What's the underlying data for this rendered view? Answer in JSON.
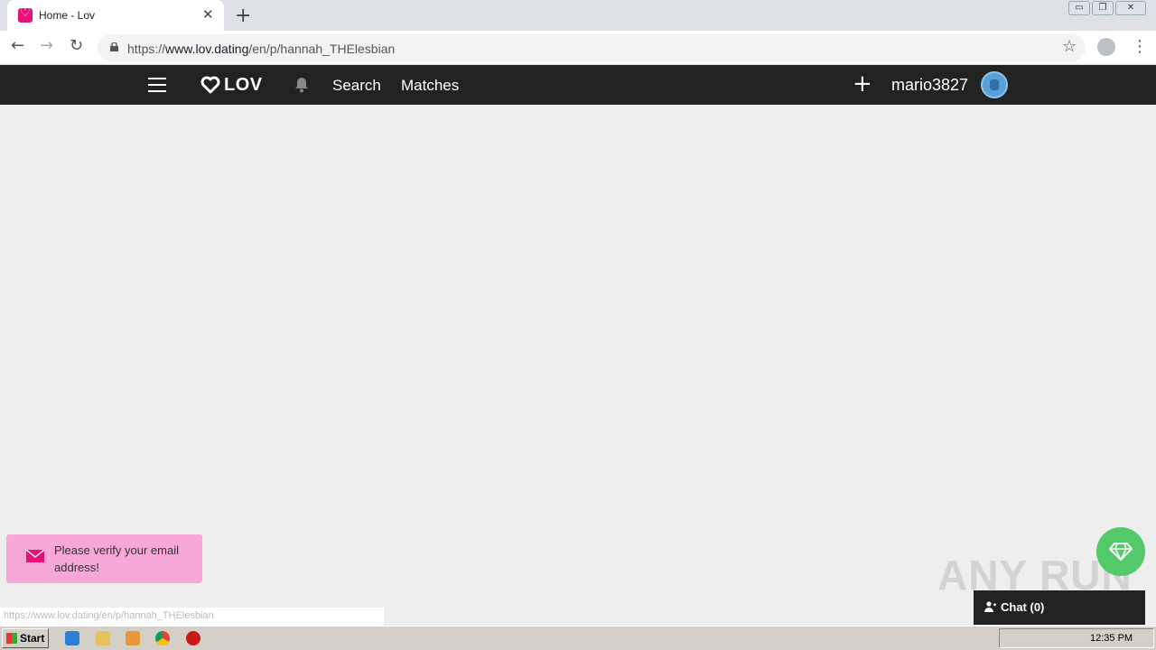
{
  "browser": {
    "tab_title": "Home - Lov",
    "tab_close": "✕",
    "new_tab": "+",
    "url_scheme": "https://",
    "url_host": "www.lov.dating",
    "url_path": "/en/p/hannah_THElesbian",
    "window_buttons": [
      "▭",
      "❐",
      "✕"
    ]
  },
  "site": {
    "logo_text": "LOV",
    "nav": {
      "search": "Search",
      "matches": "Matches"
    },
    "plus": "+",
    "username": "mario3827"
  },
  "notification": {
    "verify_text": "Please verify your email address!"
  },
  "status_bar_url": "https://www.lov.dating/en/p/hannah_THElesbian",
  "chat": {
    "label": "Chat (0)"
  },
  "watermark": "ANY RUN",
  "taskbar": {
    "start_label": "Start",
    "clock": "12:35 PM"
  },
  "colors": {
    "brand_pink": "#e8107a",
    "header_bg": "#222222",
    "page_bg": "#eeeeee",
    "gem_green": "#53c96a",
    "toast_bg": "#f7a8d8"
  }
}
